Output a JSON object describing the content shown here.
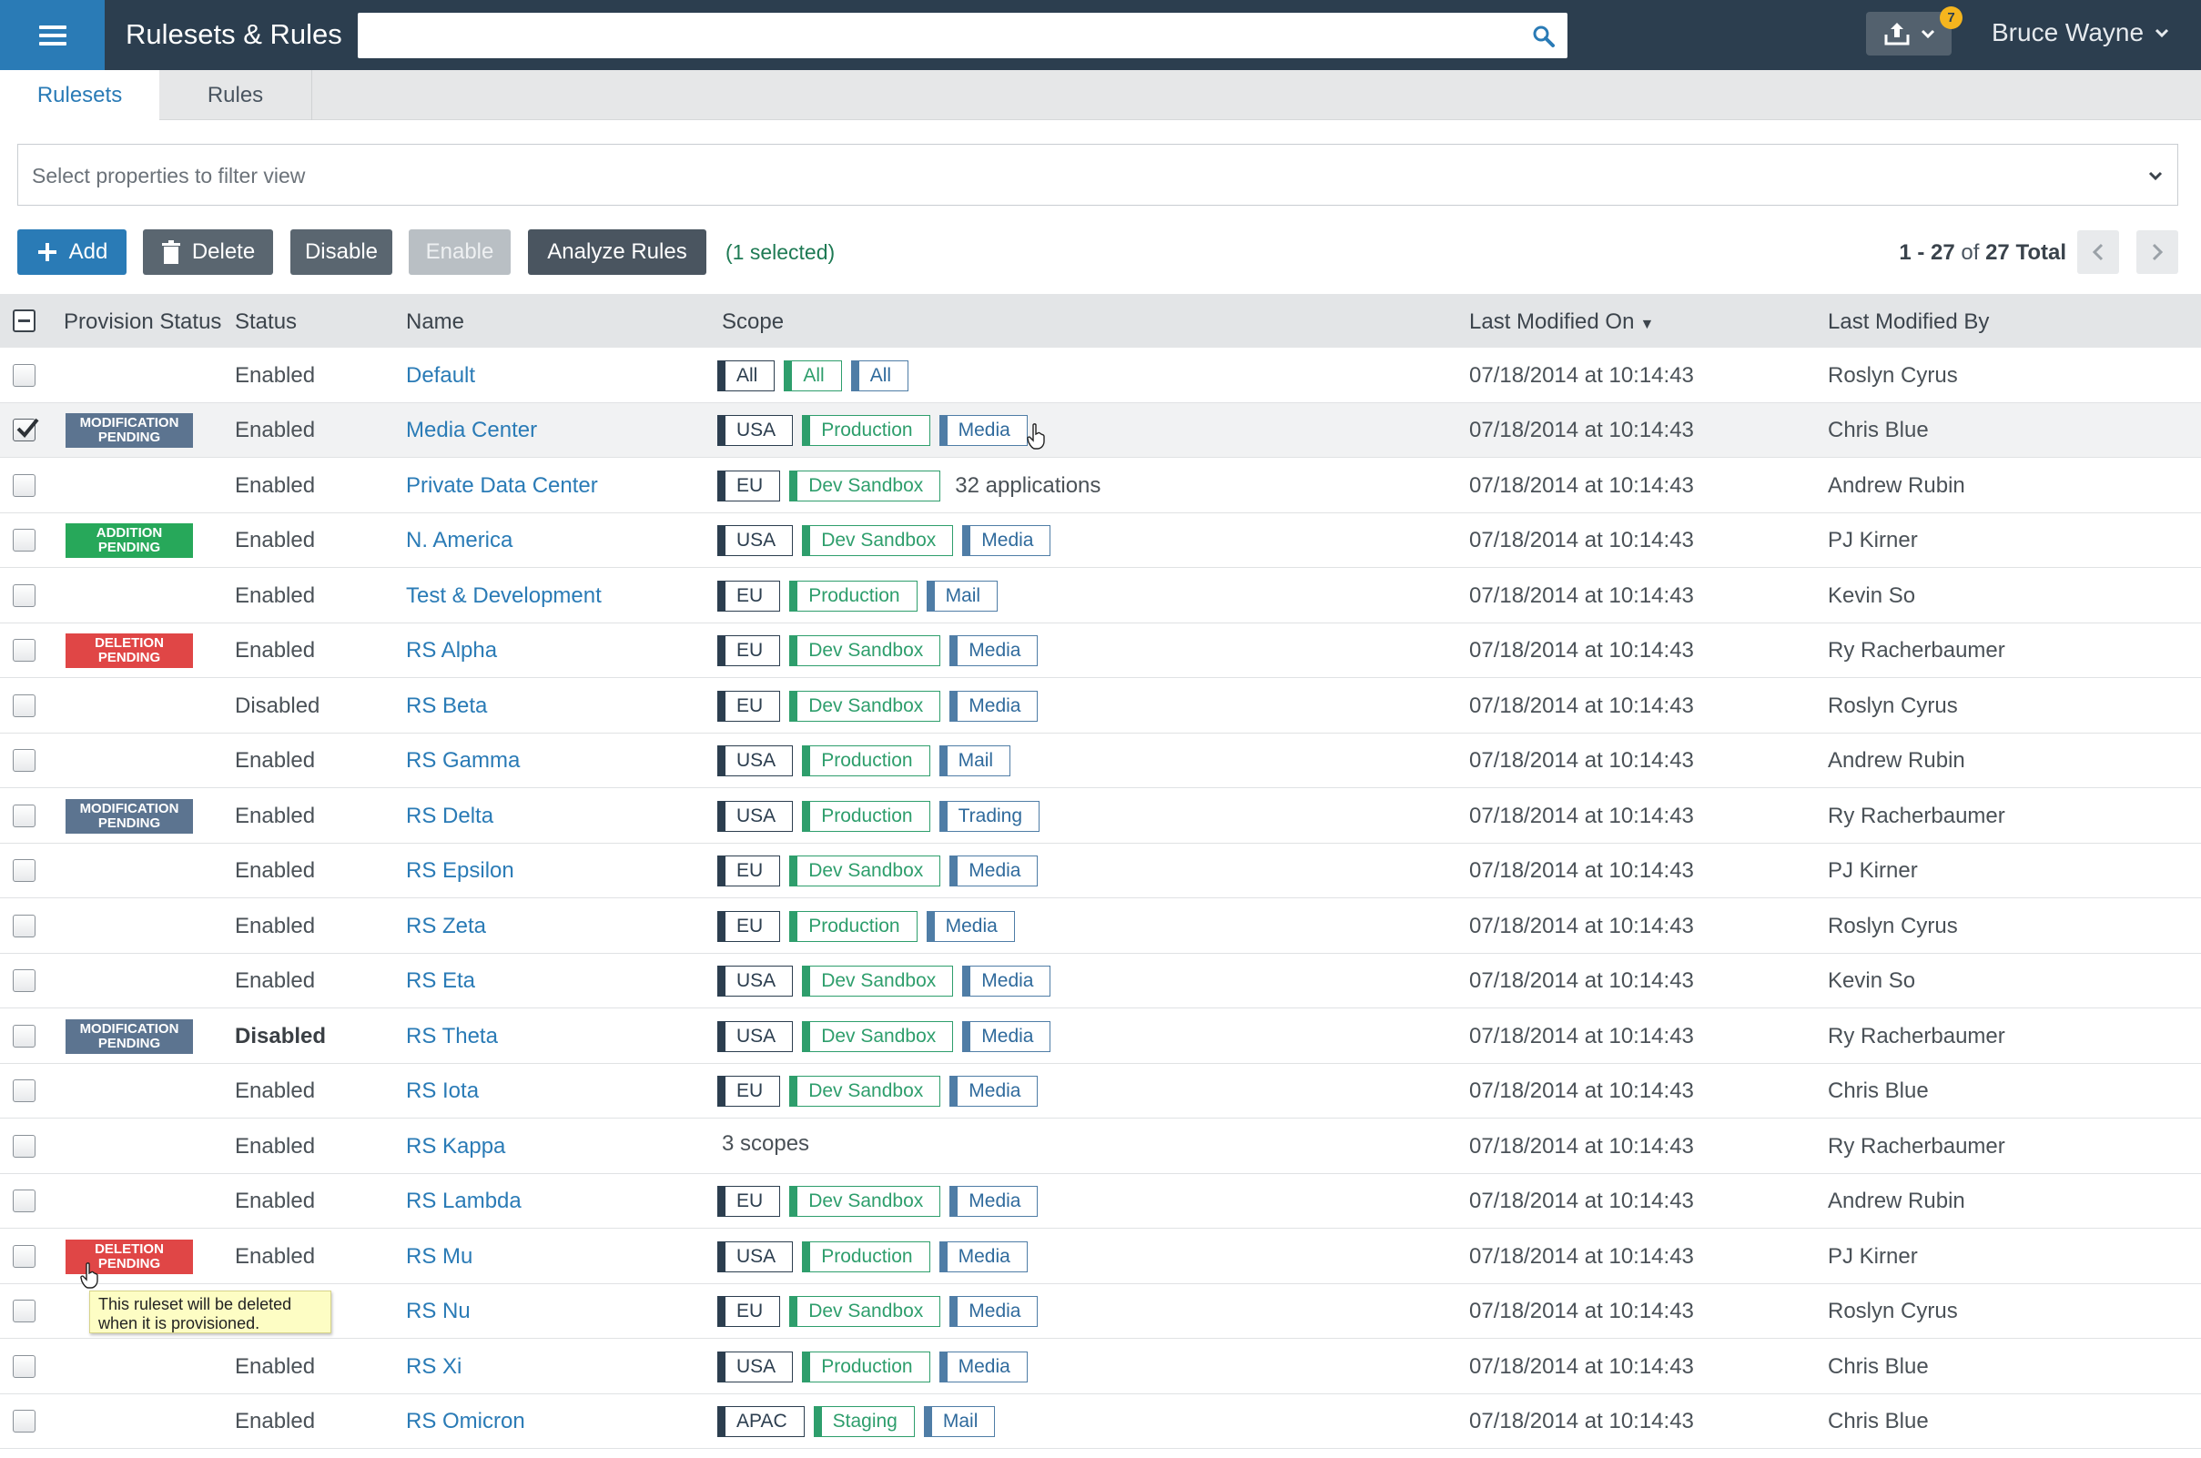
{
  "header": {
    "title": "Rulesets & Rules",
    "search_placeholder": "",
    "notification_count": "7",
    "user_name": "Bruce Wayne",
    "colors": {
      "bar": "#2c3e4f",
      "accent": "#2a7bb6",
      "badge": "#f5b51e"
    }
  },
  "tabs": [
    {
      "label": "Rulesets",
      "active": true
    },
    {
      "label": "Rules",
      "active": false
    }
  ],
  "filter": {
    "placeholder": "Select properties to filter view"
  },
  "toolbar": {
    "add_label": "Add",
    "delete_label": "Delete",
    "disable_label": "Disable",
    "enable_label": "Enable",
    "analyze_label": "Analyze Rules",
    "selected_text": "(1 selected)"
  },
  "pagination": {
    "range": "1 - 27",
    "of": "of",
    "total": "27 Total"
  },
  "table": {
    "columns": {
      "provision_status": "Provision Status",
      "status": "Status",
      "name": "Name",
      "scope": "Scope",
      "last_modified_on": "Last Modified On",
      "last_modified_by": "Last Modified By"
    },
    "sort_indicator": "▼",
    "rows": [
      {
        "checked": false,
        "prov": null,
        "prov_line1": "",
        "prov_line2": "",
        "status": "Enabled",
        "name": "Default",
        "scope": [
          "All",
          "All",
          "All"
        ],
        "scope_text": "",
        "modified_on": "07/18/2014 at 10:14:43",
        "modified_by": "Roslyn Cyrus"
      },
      {
        "checked": true,
        "prov": "modification",
        "prov_line1": "MODIFICATION",
        "prov_line2": "PENDING",
        "status": "Enabled",
        "name": "Media Center",
        "scope": [
          "USA",
          "Production",
          "Media"
        ],
        "scope_text": "",
        "modified_on": "07/18/2014 at 10:14:43",
        "modified_by": "Chris Blue"
      },
      {
        "checked": false,
        "prov": null,
        "prov_line1": "",
        "prov_line2": "",
        "status": "Enabled",
        "name": "Private Data Center",
        "scope": [
          "EU",
          "Dev Sandbox"
        ],
        "scope_text": "32 applications",
        "modified_on": "07/18/2014 at 10:14:43",
        "modified_by": "Andrew Rubin"
      },
      {
        "checked": false,
        "prov": "addition",
        "prov_line1": "ADDITION",
        "prov_line2": "PENDING",
        "status": "Enabled",
        "name": "N. America",
        "scope": [
          "USA",
          "Dev Sandbox",
          "Media"
        ],
        "scope_text": "",
        "modified_on": "07/18/2014 at 10:14:43",
        "modified_by": "PJ Kirner"
      },
      {
        "checked": false,
        "prov": null,
        "prov_line1": "",
        "prov_line2": "",
        "status": "Enabled",
        "name": "Test & Development",
        "scope": [
          "EU",
          "Production",
          "Mail"
        ],
        "scope_text": "",
        "modified_on": "07/18/2014 at 10:14:43",
        "modified_by": "Kevin So"
      },
      {
        "checked": false,
        "prov": "deletion",
        "prov_line1": "DELETION",
        "prov_line2": "PENDING",
        "status": "Enabled",
        "name": "RS Alpha",
        "scope": [
          "EU",
          "Dev Sandbox",
          "Media"
        ],
        "scope_text": "",
        "modified_on": "07/18/2014 at 10:14:43",
        "modified_by": "Ry Racherbaumer"
      },
      {
        "checked": false,
        "prov": null,
        "prov_line1": "",
        "prov_line2": "",
        "status": "Disabled",
        "name": "RS Beta",
        "scope": [
          "EU",
          "Dev Sandbox",
          "Media"
        ],
        "scope_text": "",
        "modified_on": "07/18/2014 at 10:14:43",
        "modified_by": "Roslyn Cyrus"
      },
      {
        "checked": false,
        "prov": null,
        "prov_line1": "",
        "prov_line2": "",
        "status": "Enabled",
        "name": "RS Gamma",
        "scope": [
          "USA",
          "Production",
          "Mail"
        ],
        "scope_text": "",
        "modified_on": "07/18/2014 at 10:14:43",
        "modified_by": "Andrew Rubin"
      },
      {
        "checked": false,
        "prov": "modification",
        "prov_line1": "MODIFICATION",
        "prov_line2": "PENDING",
        "status": "Enabled",
        "name": "RS Delta",
        "scope": [
          "USA",
          "Production",
          "Trading"
        ],
        "scope_text": "",
        "modified_on": "07/18/2014 at 10:14:43",
        "modified_by": "Ry Racherbaumer"
      },
      {
        "checked": false,
        "prov": null,
        "prov_line1": "",
        "prov_line2": "",
        "status": "Enabled",
        "name": "RS Epsilon",
        "scope": [
          "EU",
          "Dev Sandbox",
          "Media"
        ],
        "scope_text": "",
        "modified_on": "07/18/2014 at 10:14:43",
        "modified_by": "PJ Kirner"
      },
      {
        "checked": false,
        "prov": null,
        "prov_line1": "",
        "prov_line2": "",
        "status": "Enabled",
        "name": "RS Zeta",
        "scope": [
          "EU",
          "Production",
          "Media"
        ],
        "scope_text": "",
        "modified_on": "07/18/2014 at 10:14:43",
        "modified_by": "Roslyn Cyrus"
      },
      {
        "checked": false,
        "prov": null,
        "prov_line1": "",
        "prov_line2": "",
        "status": "Enabled",
        "name": "RS Eta",
        "scope": [
          "USA",
          "Dev Sandbox",
          "Media"
        ],
        "scope_text": "",
        "modified_on": "07/18/2014 at 10:14:43",
        "modified_by": "Kevin So"
      },
      {
        "checked": false,
        "prov": "modification",
        "prov_line1": "MODIFICATION",
        "prov_line2": "PENDING",
        "status": "Disabled",
        "status_bold": true,
        "name": "RS Theta",
        "scope": [
          "USA",
          "Dev Sandbox",
          "Media"
        ],
        "scope_text": "",
        "modified_on": "07/18/2014 at 10:14:43",
        "modified_by": "Ry Racherbaumer"
      },
      {
        "checked": false,
        "prov": null,
        "prov_line1": "",
        "prov_line2": "",
        "status": "Enabled",
        "name": "RS Iota",
        "scope": [
          "EU",
          "Dev Sandbox",
          "Media"
        ],
        "scope_text": "",
        "modified_on": "07/18/2014 at 10:14:43",
        "modified_by": "Chris Blue"
      },
      {
        "checked": false,
        "prov": null,
        "prov_line1": "",
        "prov_line2": "",
        "status": "Enabled",
        "name": "RS Kappa",
        "scope": [],
        "scope_text": "3 scopes",
        "modified_on": "07/18/2014 at 10:14:43",
        "modified_by": "Ry Racherbaumer"
      },
      {
        "checked": false,
        "prov": null,
        "prov_line1": "",
        "prov_line2": "",
        "status": "Enabled",
        "name": "RS Lambda",
        "scope": [
          "EU",
          "Dev Sandbox",
          "Media"
        ],
        "scope_text": "",
        "modified_on": "07/18/2014 at 10:14:43",
        "modified_by": "Andrew Rubin"
      },
      {
        "checked": false,
        "prov": "deletion",
        "prov_line1": "DELETION",
        "prov_line2": "PENDING",
        "status": "Enabled",
        "name": "RS Mu",
        "scope": [
          "USA",
          "Production",
          "Media"
        ],
        "scope_text": "",
        "modified_on": "07/18/2014 at 10:14:43",
        "modified_by": "PJ Kirner"
      },
      {
        "checked": false,
        "prov": null,
        "prov_line1": "",
        "prov_line2": "",
        "status": "",
        "name": "RS Nu",
        "scope": [
          "EU",
          "Dev Sandbox",
          "Media"
        ],
        "scope_text": "",
        "modified_on": "07/18/2014 at 10:14:43",
        "modified_by": "Roslyn Cyrus"
      },
      {
        "checked": false,
        "prov": null,
        "prov_line1": "",
        "prov_line2": "",
        "status": "Enabled",
        "name": "RS Xi",
        "scope": [
          "USA",
          "Production",
          "Media"
        ],
        "scope_text": "",
        "modified_on": "07/18/2014 at 10:14:43",
        "modified_by": "Chris Blue"
      },
      {
        "checked": false,
        "prov": null,
        "prov_line1": "",
        "prov_line2": "",
        "status": "Enabled",
        "name": "RS Omicron",
        "scope": [
          "APAC",
          "Staging",
          "Mail"
        ],
        "scope_text": "",
        "modified_on": "07/18/2014 at 10:14:43",
        "modified_by": "Chris Blue"
      }
    ]
  },
  "tooltip": {
    "line1": "This ruleset will be deleted",
    "line2": "when it is provisioned."
  },
  "provision_colors": {
    "modification": "#5c7490",
    "addition": "#27a85a",
    "deletion": "#e04646"
  }
}
